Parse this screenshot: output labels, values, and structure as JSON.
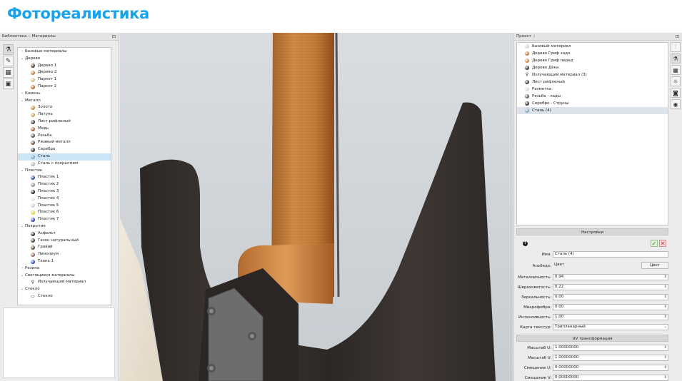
{
  "slide": {
    "title": "Фотореалистика"
  },
  "library": {
    "title": "Библиотека :: Материалы",
    "pin_icon": "pin-icon",
    "tools": [
      "materials-icon",
      "paint-icon",
      "texture-icon",
      "image-icon"
    ],
    "tree": [
      {
        "label": "Базовые материалы",
        "level": 0,
        "arrow": "›"
      },
      {
        "label": "Дерево",
        "level": 0,
        "arrow": "⌄"
      },
      {
        "label": "Дерево 1",
        "level": 1,
        "color": "#4a3526"
      },
      {
        "label": "Дерево 2",
        "level": 1,
        "color": "#c07b3a"
      },
      {
        "label": "Паркет 1",
        "level": 1,
        "color": "#d7b47b"
      },
      {
        "label": "Паркет 2",
        "level": 1,
        "color": "#b8652a"
      },
      {
        "label": "Камень",
        "level": 0,
        "arrow": "›"
      },
      {
        "label": "Металл",
        "level": 0,
        "arrow": "⌄"
      },
      {
        "label": "Золото",
        "level": 1,
        "color": "#b8892a"
      },
      {
        "label": "Латунь",
        "level": 1,
        "color": "#c9a45a"
      },
      {
        "label": "Лист рифленый",
        "level": 1,
        "color": "#3a3a3a"
      },
      {
        "label": "Медь",
        "level": 1,
        "color": "#a85a2c"
      },
      {
        "label": "Резьба",
        "level": 1,
        "color": "#555555"
      },
      {
        "label": "Ржавый металл",
        "level": 1,
        "color": "#6b4a33"
      },
      {
        "label": "Серебро",
        "level": 1,
        "color": "#2f2f2f"
      },
      {
        "label": "Сталь",
        "level": 1,
        "color": "#7ea6c7",
        "selected": true
      },
      {
        "label": "Сталь с покрытием",
        "level": 1,
        "color": "#b0b4b8"
      },
      {
        "label": "Пластик",
        "level": 0,
        "arrow": "⌄"
      },
      {
        "label": "Пластик 1",
        "level": 1,
        "color": "#2a4aa0"
      },
      {
        "label": "Пластик 2",
        "level": 1,
        "color": "#8c8c8c"
      },
      {
        "label": "Пластик 3",
        "level": 1,
        "color": "#222222"
      },
      {
        "label": "Пластик 4",
        "level": 1,
        "color": "#e2e2e2"
      },
      {
        "label": "Пластик 5",
        "level": 1,
        "color": "#d0d0d0"
      },
      {
        "label": "Пластик 6",
        "level": 1,
        "color": "#e6cf3a"
      },
      {
        "label": "Пластик 7",
        "level": 1,
        "color": "#2240b8"
      },
      {
        "label": "Покрытие",
        "level": 0,
        "arrow": "⌄"
      },
      {
        "label": "Асфальт",
        "level": 1,
        "color": "#2d2d2d"
      },
      {
        "label": "Газон натуральный",
        "level": 1,
        "color": "#3a4a2a"
      },
      {
        "label": "Гравий",
        "level": 1,
        "color": "#5a4a3a"
      },
      {
        "label": "Линолеум",
        "level": 1,
        "color": "#8a6a5a"
      },
      {
        "label": "Ткань 1",
        "level": 1,
        "color": "#2a4ac8"
      },
      {
        "label": "Резина",
        "level": 0,
        "arrow": "›"
      },
      {
        "label": "Светящиеся материалы",
        "level": 0,
        "arrow": "⌄"
      },
      {
        "label": "Излучающий материал",
        "level": 1,
        "icon": "bulb"
      },
      {
        "label": "Стекло",
        "level": 0,
        "arrow": "⌄"
      },
      {
        "label": "Стекло",
        "level": 1,
        "icon": "glass"
      }
    ]
  },
  "project": {
    "title": "Проект ::",
    "pin_icon": "pin-icon",
    "tools": [
      "tree-icon",
      "materials-icon",
      "texture-icon",
      "light-icon",
      "camera-icon",
      "photo-camera-icon"
    ],
    "items": [
      {
        "label": "Базовый материал",
        "color": "#d0d0d0"
      },
      {
        "label": "Дерево Гриф задн",
        "color": "#c07b3a"
      },
      {
        "label": "Дерево Гриф перед",
        "color": "#c8843e"
      },
      {
        "label": "Дерево Дека",
        "color": "#3a2e28"
      },
      {
        "label": "Излучающий материал (3)",
        "icon": "bulb"
      },
      {
        "label": "Лист рифленый",
        "color": "#3a3a3a"
      },
      {
        "label": "Разметка",
        "color": "#d8d8d8"
      },
      {
        "label": "Резьба - лады",
        "color": "#555555"
      },
      {
        "label": "Серебро - Струны",
        "color": "#2f2f2f"
      },
      {
        "label": "Сталь (4)",
        "color": "#7ea6c7",
        "selected": true
      }
    ]
  },
  "settings": {
    "header": "Настройки",
    "name_label": "Имя:",
    "name_value": "Сталь (4)",
    "albedo_label": "Альбедо:",
    "albedo_value": "Цвет",
    "albedo_button": "Цвет",
    "metallic_label": "Металличность:",
    "metallic_value": "0.94",
    "roughness_label": "Шероховатость:",
    "roughness_value": "0.22",
    "specular_label": "Зеркальность:",
    "specular_value": "0.00",
    "microfiber_label": "Микрофибра:",
    "microfiber_value": "0.00",
    "intensity_label": "Интенсивность:",
    "intensity_value": "1.00",
    "texture_map_label": "Карта текстур:",
    "texture_map_value": "Трипланарный"
  },
  "uv": {
    "header": "UV трансформация",
    "scale_u_label": "Масштаб U:",
    "scale_u_value": "1.00000000",
    "scale_v_label": "Масштаб V:",
    "scale_v_value": "1.00000000",
    "offset_u_label": "Смещение U:",
    "offset_u_value": "0.00000000",
    "offset_v_label": "Смещение V:",
    "offset_v_value": "0.00000000"
  },
  "colors": {
    "title_blue": "#1aa3e8",
    "selection": "#cde6f7",
    "ok_green": "#2e8b2e",
    "cancel_red": "#d42020",
    "neck_wood": "#c8843e",
    "body_wood": "#3b3532"
  }
}
